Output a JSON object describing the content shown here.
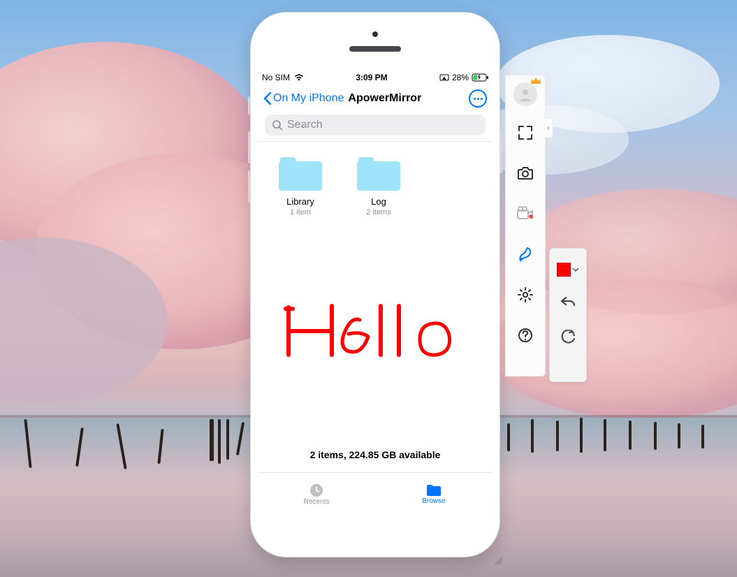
{
  "status_bar": {
    "sim_text": "No SIM",
    "time": "3:09 PM",
    "battery_percent": "28%"
  },
  "nav": {
    "back_label": "On My iPhone",
    "title": "ApowerMirror"
  },
  "search": {
    "placeholder": "Search"
  },
  "folders": [
    {
      "name": "Library",
      "subtitle": "1 item"
    },
    {
      "name": "Log",
      "subtitle": "2 items"
    }
  ],
  "annotation_text": "Hello",
  "annotation_color": "#ff0000",
  "footer": "2 items, 224.85 GB available",
  "tabs": {
    "recents": "Recents",
    "browse": "Browse"
  },
  "flyout": {
    "swatch_color": "#ff0000"
  }
}
